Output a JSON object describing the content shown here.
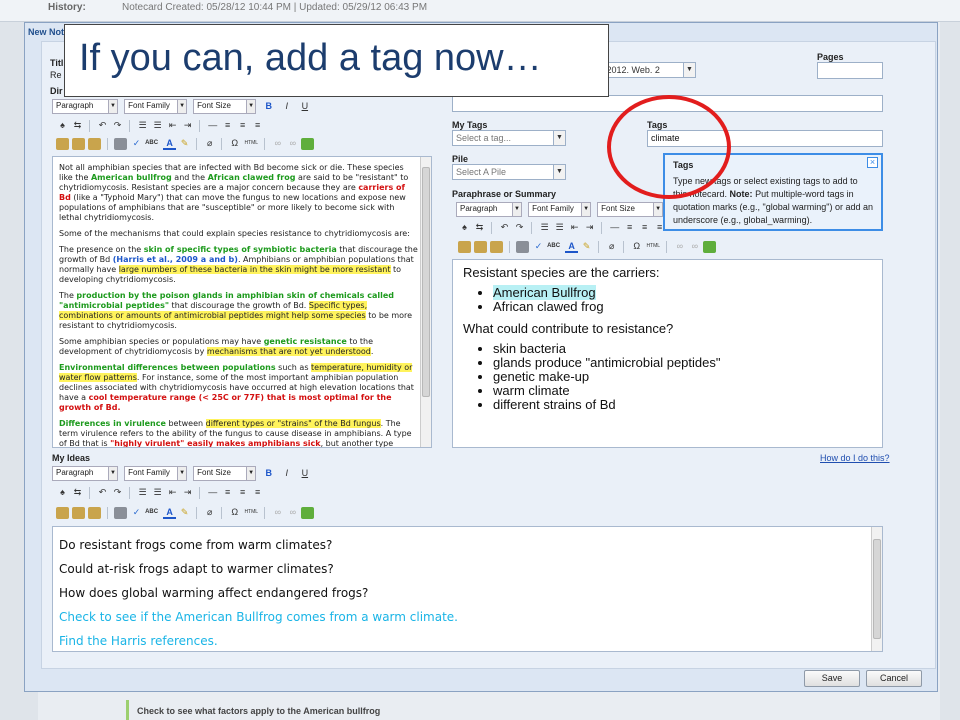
{
  "background": {
    "history_label": "History:",
    "created_text": "Notecard Created: 05/28/12 10:44 PM | Updated: 05/29/12 06:43 PM",
    "bottom_text": "Check to see what factors apply to the American bullfrog"
  },
  "dialog": {
    "title": "New Note",
    "callout": "If you can, add a tag now…",
    "fields": {
      "title_label": "Titl",
      "title_value": "Re",
      "direct_label": "Dir",
      "source_value": "rk, 2012. Web. 2",
      "pages_label": "Pages",
      "my_tags_label": "My Tags",
      "my_tags_placeholder": "Select a tag...",
      "tags_label": "Tags",
      "tags_value": "climate",
      "pile_label": "Pile",
      "pile_placeholder": "Select A Pile",
      "paraphrase_label": "Paraphrase or Summary",
      "my_ideas_label": "My Ideas",
      "help_link": "How do I do this?"
    },
    "toolbar": {
      "paragraph": "Paragraph",
      "font_family": "Font Family",
      "font_size": "Font Size",
      "bold": "B",
      "italic": "I",
      "underline": "U",
      "omega": "Ω",
      "html": "HTML",
      "abc": "ABC",
      "a": "A"
    },
    "tag_popup": {
      "title": "Tags",
      "text1": "Type new tags or select existing tags to add to this notecard.",
      "note_label": "Note:",
      "text2": "Put multiple-word tags in quotation marks (e.g., \"global warming\") or add an underscore (e.g., global_warming).",
      "close": "×"
    },
    "source_text": {
      "p1a": "Not all amphibian species that are infected with Bd become sick or die. These species like the ",
      "p1b": "American bullfrog",
      "p1c": " and the ",
      "p1d": "African clawed frog",
      "p1e": " are said to be \"resistant\" to chytridiomycosis. Resistant species are a major concern because they are ",
      "p1f": "carriers of Bd",
      "p1g": " (like a \"Typhoid Mary\") that can move the fungus to new locations and expose new populations of amphibians that are \"susceptible\" or more likely to become sick with lethal chytridiomycosis.",
      "p2": "Some of the mechanisms that could explain species resistance to chytridiomycosis are:",
      "p3a": "The presence on the ",
      "p3b": "skin of specific types of symbiotic bacteria",
      "p3c": " that discourage the growth of Bd ",
      "p3d": "(Harris et al., 2009 a and b)",
      "p3e": ". Amphibians or amphibian populations that normally have ",
      "p3f": "large numbers of these bacteria in the skin might be more resistant",
      "p3g": " to developing chytridiomycosis.",
      "p4a": "The ",
      "p4b": "production by the poison glands in amphibian skin of chemicals called \"antimicrobial peptides\"",
      "p4c": " that discourage the growth of Bd. ",
      "p4d": "Specific types, combinations or amounts of antimicrobial peptides might help some species",
      "p4e": " to be more resistant to chytridiomycosis.",
      "p5a": "Some amphibian species or populations may have ",
      "p5b": "genetic resistance",
      "p5c": " to the development of chytridiomycosis by ",
      "p5d": "mechanisms that are not yet understood",
      "p5e": ".",
      "p6a": "Environmental differences between populations",
      "p6b": " such as ",
      "p6c": "temperature, humidity or water flow patterns",
      "p6d": ". For instance, some of the most important amphibian population declines associated with chytridiomycosis have occurred at high elevation locations that have a ",
      "p6e": "cool temperature range (< 25C or 77F) that is most optimal for the growth of Bd.",
      "p7a": "Differences in virulence",
      "p7b": " between ",
      "p7c": "different types or \"strains\" of the Bd fungus",
      "p7d": ". The term virulence refers to the ability of the fungus to cause disease in amphibians. A type of Bd that is ",
      "p7e": "\"highly virulent\" easily makes amphibians sick",
      "p7f": ", but another type"
    },
    "paraphrase": {
      "heading1": "Resistant species are the carriers:",
      "list1": [
        "American Bullfrog",
        "African clawed frog"
      ],
      "heading2": "What could contribute to resistance?",
      "list2": [
        "skin bacteria",
        "glands produce \"antimicrobial peptides\"",
        "genetic make-up",
        "warm climate",
        "different strains of Bd"
      ]
    },
    "ideas": [
      "Do resistant frogs come from warm climates?",
      "Could at-risk frogs adapt to warmer climates?",
      "How does global warming affect endangered frogs?",
      "Check to see if the American Bullfrog comes from a warm climate.",
      "Find the Harris references."
    ],
    "buttons": {
      "save": "Save",
      "cancel": "Cancel"
    }
  },
  "colors": {
    "highlight_yellow": "#fff35c",
    "highlight_cyan": "#b8f0f4",
    "text_red": "#d31010",
    "text_green": "#1d9a1d",
    "text_blue": "#1d56c9",
    "idea_cyan": "#19b4e6",
    "circle_red": "#e21d1d"
  }
}
